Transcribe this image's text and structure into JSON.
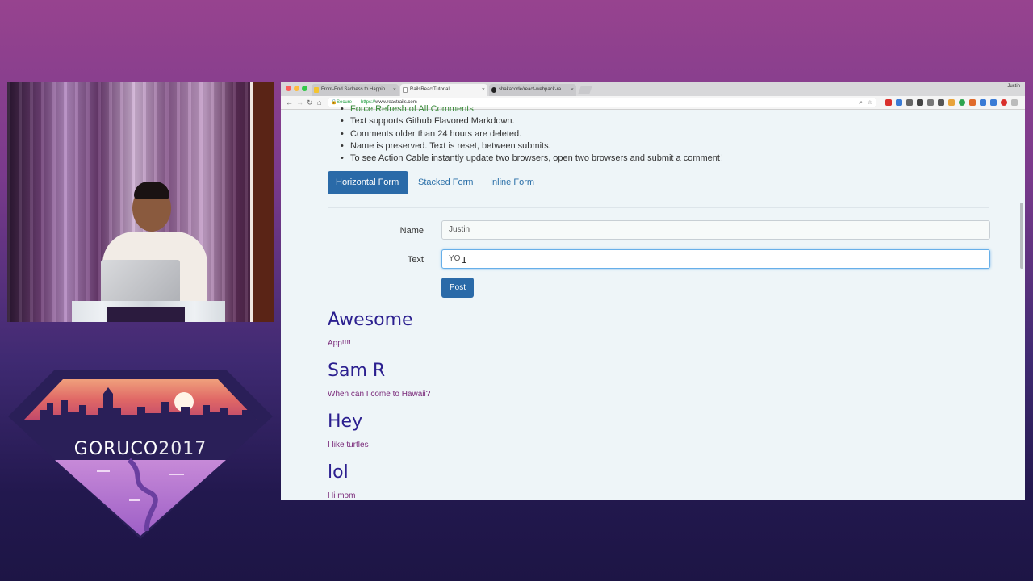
{
  "event": {
    "name": "GORUCO",
    "year": "2017"
  },
  "browser": {
    "tabs": [
      {
        "title": "Front-End Sadness to Happin",
        "active": false
      },
      {
        "title": "RailsReactTutorial",
        "active": true
      },
      {
        "title": "shakacode/react-webpack-ra",
        "active": false
      }
    ],
    "profile": "Justin",
    "address": {
      "secure_label": "Secure",
      "scheme": "https://",
      "host": "www.reactrails.com"
    }
  },
  "notes": [
    "Force Refresh of All Comments.",
    "Text supports Github Flavored Markdown.",
    "Comments older than 24 hours are deleted.",
    "Name is preserved. Text is reset, between submits.",
    "To see Action Cable instantly update two browsers, open two browsers and submit a comment!"
  ],
  "form_tabs": [
    "Horizontal Form",
    "Stacked Form",
    "Inline Form"
  ],
  "form": {
    "name_label": "Name",
    "name_value": "Justin",
    "text_label": "Text",
    "text_value": "YO",
    "submit_label": "Post"
  },
  "comments": [
    {
      "author": "Awesome",
      "text": "App!!!!"
    },
    {
      "author": "Sam R",
      "text": "When can I come to Hawaii?"
    },
    {
      "author": "Hey",
      "text": "I like turtles"
    },
    {
      "author": "lol",
      "text": "Hi mom"
    }
  ],
  "colors": {
    "primary": "#2a6aa8",
    "author": "#2b1f8f",
    "comment_text": "#7a2a7a"
  }
}
